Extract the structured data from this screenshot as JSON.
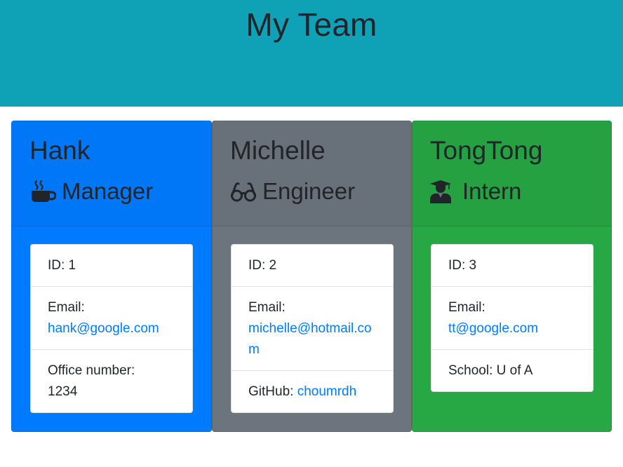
{
  "header": {
    "title": "My Team"
  },
  "colors": {
    "header_bg": "#0fa2b7",
    "manager_bg": "#007bff",
    "engineer_bg": "#6c757d",
    "intern_bg": "#28a745",
    "link": "#007bff"
  },
  "cards": [
    {
      "name": "Hank",
      "role": "Manager",
      "role_icon": "coffee-mug-icon",
      "id_text": "ID: 1",
      "email_label": "Email:",
      "email": "hank@google.com",
      "extra_label": "Office number:",
      "extra_value": "1234"
    },
    {
      "name": "Michelle",
      "role": "Engineer",
      "role_icon": "glasses-icon",
      "id_text": "ID: 2",
      "email_label": "Email:",
      "email": "michelle@hotmail.com",
      "extra_label": "GitHub:",
      "extra_value": "choumrdh"
    },
    {
      "name": "TongTong",
      "role": "Intern",
      "role_icon": "graduate-icon",
      "id_text": "ID: 3",
      "email_label": "Email:",
      "email": "tt@google.com",
      "extra_label": "School:",
      "extra_value": "U of A"
    }
  ]
}
